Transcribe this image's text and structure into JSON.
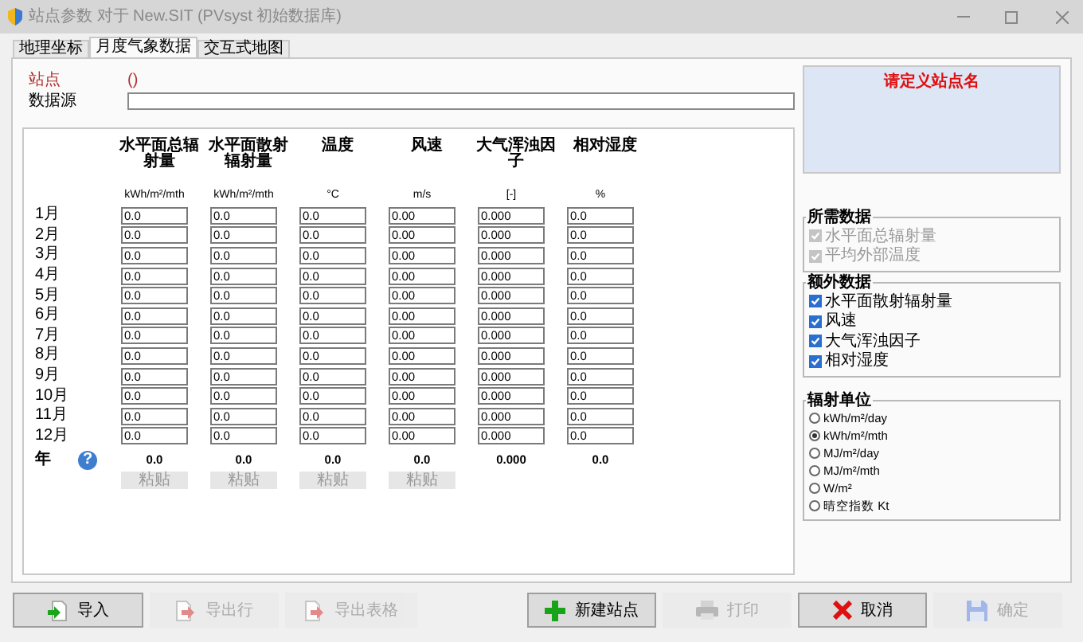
{
  "window": {
    "title": "站点参数 对于 New.SIT (PVsyst 初始数据库)"
  },
  "tabs": [
    {
      "label": "地理坐标",
      "selected": false
    },
    {
      "label": "月度气象数据",
      "selected": true
    },
    {
      "label": "交互式地图",
      "selected": false
    }
  ],
  "site": {
    "label": "站点",
    "value": "()"
  },
  "database": {
    "label": "数据源"
  },
  "table": {
    "columns": [
      {
        "header": "水平面总辐射量",
        "unit": "kWh/m²/mth",
        "total": "0.0",
        "paste": "粘贴"
      },
      {
        "header": "水平面散射辐射量",
        "unit": "kWh/m²/mth",
        "total": "0.0",
        "paste": "粘贴"
      },
      {
        "header": "温度",
        "unit": "°C",
        "total": "0.0",
        "paste": "粘贴"
      },
      {
        "header": "风速",
        "unit": "m/s",
        "total": "0.0",
        "paste": "粘贴"
      },
      {
        "header": "大气浑浊因子",
        "unit": "[-]",
        "total": "0.000"
      },
      {
        "header": "相对湿度",
        "unit": "%",
        "total": "0.0"
      }
    ],
    "rows": [
      {
        "month": "1月",
        "values": [
          "0.0",
          "0.0",
          "0.0",
          "0.00",
          "0.000",
          "0.0"
        ]
      },
      {
        "month": "2月",
        "values": [
          "0.0",
          "0.0",
          "0.0",
          "0.00",
          "0.000",
          "0.0"
        ]
      },
      {
        "month": "3月",
        "values": [
          "0.0",
          "0.0",
          "0.0",
          "0.00",
          "0.000",
          "0.0"
        ]
      },
      {
        "month": "4月",
        "values": [
          "0.0",
          "0.0",
          "0.0",
          "0.00",
          "0.000",
          "0.0"
        ]
      },
      {
        "month": "5月",
        "values": [
          "0.0",
          "0.0",
          "0.0",
          "0.00",
          "0.000",
          "0.0"
        ]
      },
      {
        "month": "6月",
        "values": [
          "0.0",
          "0.0",
          "0.0",
          "0.00",
          "0.000",
          "0.0"
        ]
      },
      {
        "month": "7月",
        "values": [
          "0.0",
          "0.0",
          "0.0",
          "0.00",
          "0.000",
          "0.0"
        ]
      },
      {
        "month": "8月",
        "values": [
          "0.0",
          "0.0",
          "0.0",
          "0.00",
          "0.000",
          "0.0"
        ]
      },
      {
        "month": "9月",
        "values": [
          "0.0",
          "0.0",
          "0.0",
          "0.00",
          "0.000",
          "0.0"
        ]
      },
      {
        "month": "10月",
        "values": [
          "0.0",
          "0.0",
          "0.0",
          "0.00",
          "0.000",
          "0.0"
        ]
      },
      {
        "month": "11月",
        "values": [
          "0.0",
          "0.0",
          "0.0",
          "0.00",
          "0.000",
          "0.0"
        ]
      },
      {
        "month": "12月",
        "values": [
          "0.0",
          "0.0",
          "0.0",
          "0.00",
          "0.000",
          "0.0"
        ]
      }
    ],
    "year_label": "年",
    "help": "?"
  },
  "site_name_prompt": "请定义站点名",
  "required_data": {
    "title": "所需数据",
    "items": [
      {
        "label": "水平面总辐射量",
        "checked": true,
        "disabled": true
      },
      {
        "label": "平均外部温度",
        "checked": true,
        "disabled": true
      }
    ]
  },
  "extra_data": {
    "title": "额外数据",
    "items": [
      {
        "label": "水平面散射辐射量",
        "checked": true,
        "disabled": false
      },
      {
        "label": "风速",
        "checked": true,
        "disabled": false
      },
      {
        "label": "大气浑浊因子",
        "checked": true,
        "disabled": false
      },
      {
        "label": "相对湿度",
        "checked": true,
        "disabled": false
      }
    ]
  },
  "radiation_units": {
    "title": "辐射单位",
    "options": [
      {
        "label": "kWh/m²/day",
        "selected": false
      },
      {
        "label": "kWh/m²/mth",
        "selected": true
      },
      {
        "label": "MJ/m²/day",
        "selected": false
      },
      {
        "label": "MJ/m²/mth",
        "selected": false
      },
      {
        "label": "W/m²",
        "selected": false
      },
      {
        "label": "晴空指数 Kt",
        "selected": false
      }
    ]
  },
  "buttons": [
    {
      "label": "导入",
      "disabled": false
    },
    {
      "label": "导出行",
      "disabled": true
    },
    {
      "label": "导出表格",
      "disabled": true
    },
    {
      "label": "新建站点",
      "disabled": false
    },
    {
      "label": "打印",
      "disabled": true
    },
    {
      "label": "取消",
      "disabled": false
    },
    {
      "label": "确定",
      "disabled": true
    }
  ]
}
